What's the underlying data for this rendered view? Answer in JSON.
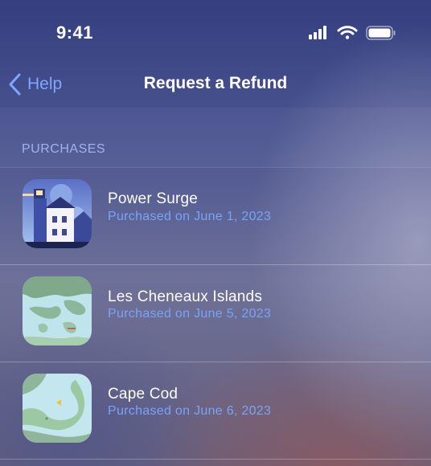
{
  "status_bar": {
    "time": "9:41",
    "icons": [
      "signal-icon",
      "wifi-icon",
      "battery-icon"
    ]
  },
  "nav": {
    "back_label": "Help",
    "title": "Request a Refund",
    "accent_color": "#7fa7ff"
  },
  "section": {
    "header": "PURCHASES"
  },
  "purchases": [
    {
      "title": "Power Surge",
      "subtitle": "Purchased on June 1, 2023",
      "icon": "lighthouse-artwork"
    },
    {
      "title": "Les Cheneaux Islands",
      "subtitle": "Purchased on June 5, 2023",
      "icon": "islands-map-artwork"
    },
    {
      "title": "Cape Cod",
      "subtitle": "Purchased on June 6, 2023",
      "icon": "cape-cod-map-artwork"
    }
  ]
}
